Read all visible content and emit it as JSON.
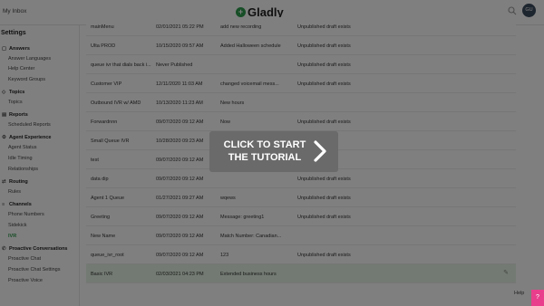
{
  "header": {
    "inbox_label": "My Inbox",
    "brand_name": "Gladly",
    "brand_color": "#2e9c4e",
    "avatar_initials": "GU",
    "search_icon": "search-icon"
  },
  "sidebar": {
    "title": "Settings",
    "sections": [
      {
        "label": "Answers",
        "icon": "chat-icon",
        "items": [
          "Answer Languages",
          "Help Center",
          "Keyword Groups"
        ]
      },
      {
        "label": "Topics",
        "icon": "tag-icon",
        "items": [
          "Topics"
        ]
      },
      {
        "label": "Reports",
        "icon": "chart-icon",
        "items": [
          "Scheduled Reports"
        ]
      },
      {
        "label": "Agent Experience",
        "icon": "gear-icon",
        "items": [
          "Agent Status",
          "Idle Timing",
          "Relationships"
        ]
      },
      {
        "label": "Routing",
        "icon": "routing-icon",
        "items": [
          "Rules"
        ]
      },
      {
        "label": "Channels",
        "icon": "channels-icon",
        "items": [
          "Phone Numbers",
          "Sidekick",
          "IVR"
        ]
      },
      {
        "label": "Proactive Conversations",
        "icon": "proactive-icon",
        "items": [
          "Proactive Chat",
          "Proactive Chat Settings",
          "Proactive Voice"
        ]
      }
    ],
    "active_item": "IVR"
  },
  "table": {
    "rows": [
      {
        "name": "mainMenu",
        "date": "02/01/2021 05:22 PM",
        "desc": "add new recording",
        "status": "Unpublished draft exists"
      },
      {
        "name": "Ulta PROD",
        "date": "10/15/2020 09:57 AM",
        "desc": "Added Halloween schedule",
        "status": "Unpublished draft exists"
      },
      {
        "name": "queue ivr that dials back i...",
        "date": "Never Published",
        "desc": "",
        "status": "Unpublished draft exists"
      },
      {
        "name": "Customer VIP",
        "date": "12/11/2020 11:03 AM",
        "desc": "changed voicemail mess...",
        "status": "Unpublished draft exists"
      },
      {
        "name": "Outbound IVR w/ AMD",
        "date": "10/13/2020 11:23 AM",
        "desc": "New hours",
        "status": ""
      },
      {
        "name": "Forwardnnn",
        "date": "09/07/2020 09:12 AM",
        "desc": "Now",
        "status": "Unpublished draft exists"
      },
      {
        "name": "Small Queue IVR",
        "date": "10/28/2020 09:23 AM",
        "desc": "",
        "status": ""
      },
      {
        "name": "test",
        "date": "09/07/2020 09:12 AM",
        "desc": "",
        "status": "...t exists"
      },
      {
        "name": "data dip",
        "date": "09/07/2020 09:12 AM",
        "desc": "",
        "status": "Unpublished draft exists"
      },
      {
        "name": "Agent 1 Queue",
        "date": "01/27/2021 09:27 AM",
        "desc": "wqews",
        "status": "Unpublished draft exists"
      },
      {
        "name": "Greeting",
        "date": "09/07/2020 09:12 AM",
        "desc": "Message: greeting1",
        "status": "Unpublished draft exists"
      },
      {
        "name": "New Name",
        "date": "09/07/2020 09:12 AM",
        "desc": "Match Number: Canadian...",
        "status": ""
      },
      {
        "name": "queue_ivr_root",
        "date": "09/07/2020 09:12 AM",
        "desc": "123",
        "status": "Unpublished draft exists"
      },
      {
        "name": "Basic IVR",
        "date": "02/03/2021 04:23 PM",
        "desc": "Extended business hours",
        "status": ""
      }
    ],
    "selected_row": "Basic IVR",
    "edit_icon": "pencil-icon"
  },
  "tutorial": {
    "text": "CLICK TO START THE TUTORIAL",
    "arrow_icon": "chevron-right-icon"
  },
  "footer": {
    "help_label": "Help",
    "help_button_icon": "question-icon",
    "help_button_symbol": "?",
    "help_button_color": "#e83e8c"
  }
}
